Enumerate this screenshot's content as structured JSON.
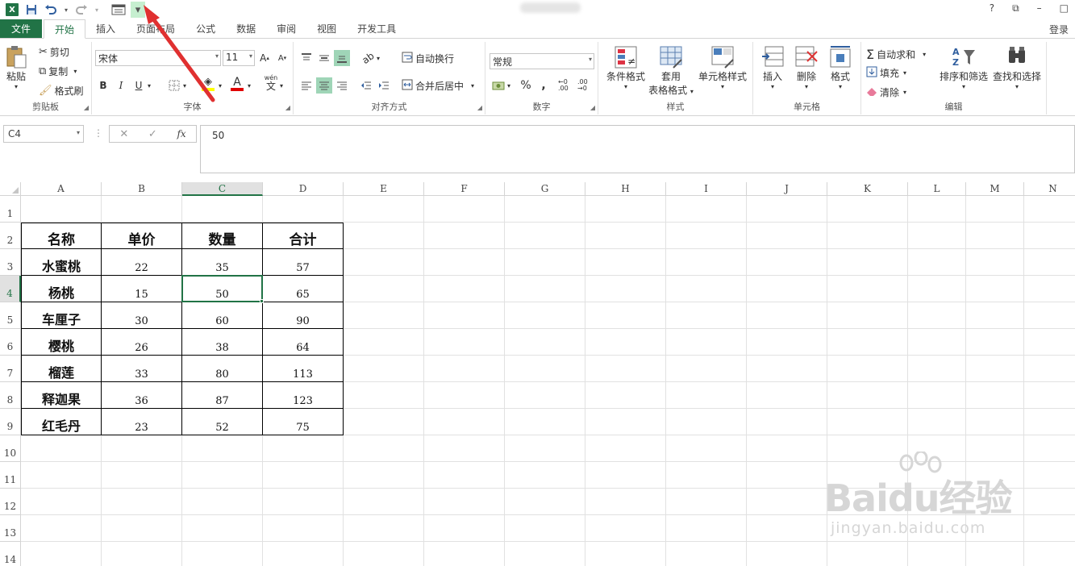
{
  "app": {
    "logo": "X"
  },
  "qat": {
    "icons": [
      "excel-icon",
      "save-icon",
      "undo-icon",
      "redo-icon",
      "form-icon",
      "customize-qat-icon"
    ]
  },
  "window": {
    "help": "?",
    "restore": "⧉",
    "minimize": "–",
    "maximize": "□"
  },
  "tabs": [
    "文件",
    "开始",
    "插入",
    "页面布局",
    "公式",
    "数据",
    "审阅",
    "视图",
    "开发工具"
  ],
  "active_tab": "开始",
  "login": "登录",
  "ribbon": {
    "clipboard": {
      "paste": "粘贴",
      "cut": "剪切",
      "copy": "复制",
      "format_painter": "格式刷",
      "label": "剪贴板"
    },
    "font": {
      "name": "宋体",
      "size": "11",
      "bold": "B",
      "italic": "I",
      "underline": "U",
      "wen": "wén",
      "wen_char": "文",
      "label": "字体",
      "font_color": "#e00000",
      "fill_color": "#ffff00"
    },
    "align": {
      "wrap": "自动换行",
      "merge": "合并后居中",
      "label": "对齐方式"
    },
    "number": {
      "format": "常规",
      "percent": "%",
      "comma": ",",
      "inc_dec": "←0 .00",
      "dec_dec": ".00 →0",
      "label": "数字"
    },
    "styles": {
      "cond": "条件格式",
      "table_fmt_1": "套用",
      "table_fmt_2": "表格格式",
      "cell_style": "单元格样式",
      "label": "样式"
    },
    "cells": {
      "insert": "插入",
      "delete": "删除",
      "format": "格式",
      "label": "单元格"
    },
    "editing": {
      "autosum": "自动求和",
      "fill": "填充",
      "clear": "清除",
      "sort": "排序和筛选",
      "find": "查找和选择",
      "label": "编辑"
    }
  },
  "formula_bar": {
    "name_box": "C4",
    "cancel": "✕",
    "enter": "✓",
    "fx": "fx",
    "content": "50"
  },
  "columns": [
    "A",
    "B",
    "C",
    "D",
    "E",
    "F",
    "G",
    "H",
    "I",
    "J",
    "K",
    "L",
    "M",
    "N"
  ],
  "rows": [
    "1",
    "2",
    "3",
    "4",
    "5",
    "6",
    "7",
    "8",
    "9",
    "10",
    "11",
    "12",
    "13",
    "14"
  ],
  "selected": {
    "column": "C",
    "row": "4"
  },
  "table": {
    "headers": [
      "名称",
      "单价",
      "数量",
      "合计"
    ],
    "rows": [
      [
        "水蜜桃",
        "22",
        "35",
        "57"
      ],
      [
        "杨桃",
        "15",
        "50",
        "65"
      ],
      [
        "车厘子",
        "30",
        "60",
        "90"
      ],
      [
        "樱桃",
        "26",
        "38",
        "64"
      ],
      [
        "榴莲",
        "33",
        "80",
        "113"
      ],
      [
        "释迦果",
        "36",
        "87",
        "123"
      ],
      [
        "红毛丹",
        "23",
        "52",
        "75"
      ]
    ]
  },
  "watermark": {
    "main": "Baidu经验",
    "sub": "jingyan.baidu.com"
  },
  "accent": "#217346"
}
